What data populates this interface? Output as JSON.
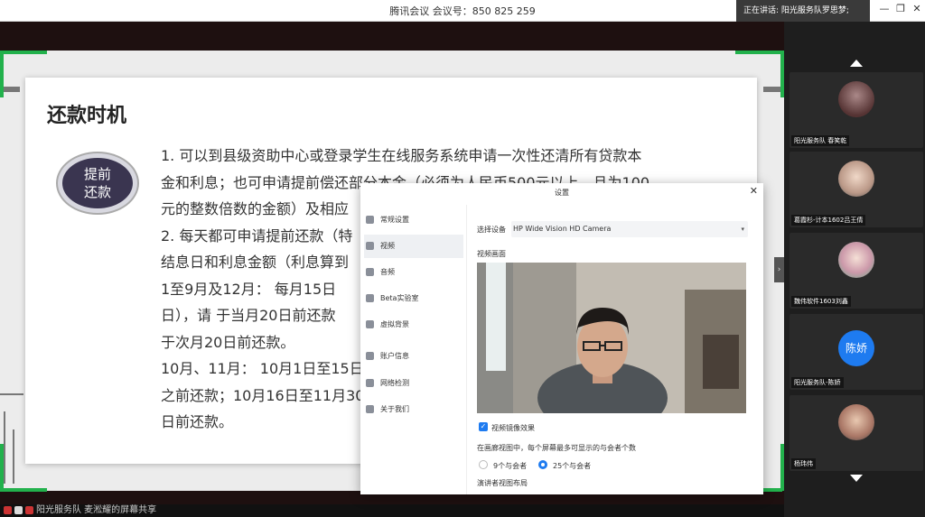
{
  "titlebar": {
    "title": "腾讯会议 会议号：850 825 259",
    "speaking": "正在讲话: 阳光服务队罗思梦;",
    "minimize": "—",
    "restore": "❐",
    "close": "✕"
  },
  "slide": {
    "title": "还款时机",
    "badge": [
      "提前",
      "还款"
    ],
    "lines": [
      " 1. 可以到县级资助中心或登录学生在线服务系统申请一次性还清所有贷款本",
      "金和利息；也可申请提前偿还部分本金（必须为人民币500元以上，且为100",
      "元的整数倍数的金额）及相应",
      " 2. 每天都可申请提前还款（特",
      "结息日和利息金额（利息算到",
      "    1至9月及12月：  每月15日",
      "日），请    于当月20日前还款",
      "于次月20日前还款。",
      "    10月、11月：  10月1日至15日",
      "之前还款；10月16日至11月30",
      "日前还款。"
    ]
  },
  "sidebar": {
    "participants": [
      {
        "name": "阳光服务队 春笑乾",
        "avatar": "photo"
      },
      {
        "name": "葛霞杉-计本1602吕王倩",
        "avatar": "photo"
      },
      {
        "name": "魏伟软件1603刘鑫",
        "avatar": "photo"
      },
      {
        "name": "阳光服务队-陈娇",
        "avatar_text": "陈娇"
      },
      {
        "name": "杨玮伟",
        "avatar": "photo"
      }
    ],
    "toggle": "›"
  },
  "bottom": {
    "sharing_text": "阳光服务队 麦淞耀的屏幕共享"
  },
  "settings": {
    "title": "设置",
    "close": "✕",
    "nav": [
      "常规设置",
      "视频",
      "音频",
      "Beta实验室",
      "虚拟背景",
      "账户信息",
      "网络检测",
      "关于我们"
    ],
    "active_nav": "视频",
    "device_label": "选择设备",
    "device_value": "HP Wide Vision HD Camera",
    "preview_label": "视频画面",
    "mirror_label": "视频镜像效果",
    "mirror_checked": true,
    "gallery_label": "在画廊视图中，每个屏幕最多可显示的与会者个数",
    "option_9": "9个与会者",
    "option_25": "25个与会者",
    "selected_option": "25个与会者",
    "speaker_layout_label": "演讲者视图布局"
  },
  "colors": {
    "accent": "#1e7bf0",
    "share_border": "#22b14c"
  }
}
